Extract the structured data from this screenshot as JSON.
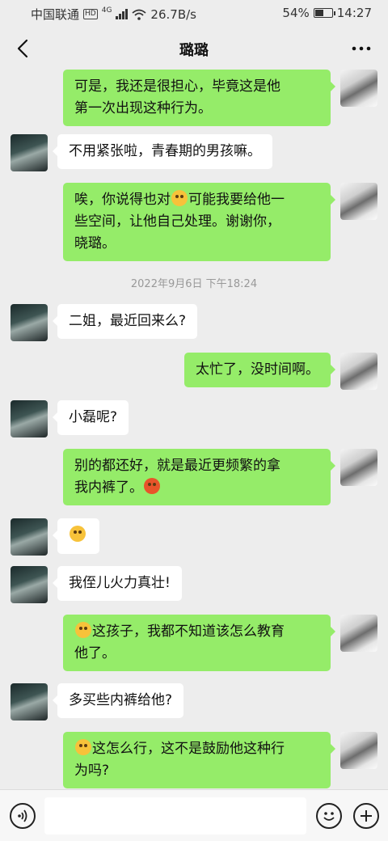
{
  "status_bar": {
    "carrier": "中国联通",
    "hd": "HD",
    "network": "4G",
    "speed": "26.7B/s",
    "battery": "54%",
    "battery_level": 0.54,
    "time": "14:27"
  },
  "nav": {
    "title": "璐璐"
  },
  "timestamp": "2022年9月6日 下午18:24",
  "messages": [
    {
      "from": "me",
      "lines": [
        "可是，我还是很担心，毕竟这是他",
        "第一次出现这种行为。"
      ]
    },
    {
      "from": "other",
      "text": "不用紧张啦，青春期的男孩嘛。"
    },
    {
      "from": "me",
      "line1_a": "唉，你说得也对",
      "line1_b": "可能我要给他一",
      "line2": "些空间，让他自己处理。谢谢你，",
      "line3": "晓璐。"
    },
    {
      "from": "other",
      "text": "二姐，最近回来么?"
    },
    {
      "from": "me",
      "text": "太忙了，没时间啊。"
    },
    {
      "from": "other",
      "text": "小磊呢?"
    },
    {
      "from": "me",
      "line1": "别的都还好，就是最近更频繁的拿",
      "line2": "我内裤了。"
    },
    {
      "from": "other",
      "text": ""
    },
    {
      "from": "other",
      "text": "我侄儿火力真壮!"
    },
    {
      "from": "me",
      "line1": "这孩子，我都不知道该怎么教育",
      "line2": "他了。"
    },
    {
      "from": "other",
      "text": "多买些内裤给他?"
    },
    {
      "from": "me",
      "line1": "这怎么行，这不是鼓励他这种行",
      "line2": "为吗?"
    }
  ],
  "icons": {
    "back": "chevron-left",
    "more": "ellipsis",
    "voice": "voice-wave",
    "emoji": "smiley",
    "plus": "plus-circle"
  },
  "colors": {
    "my_bubble": "#95ec69",
    "other_bubble": "#ffffff",
    "background": "#ededed"
  }
}
